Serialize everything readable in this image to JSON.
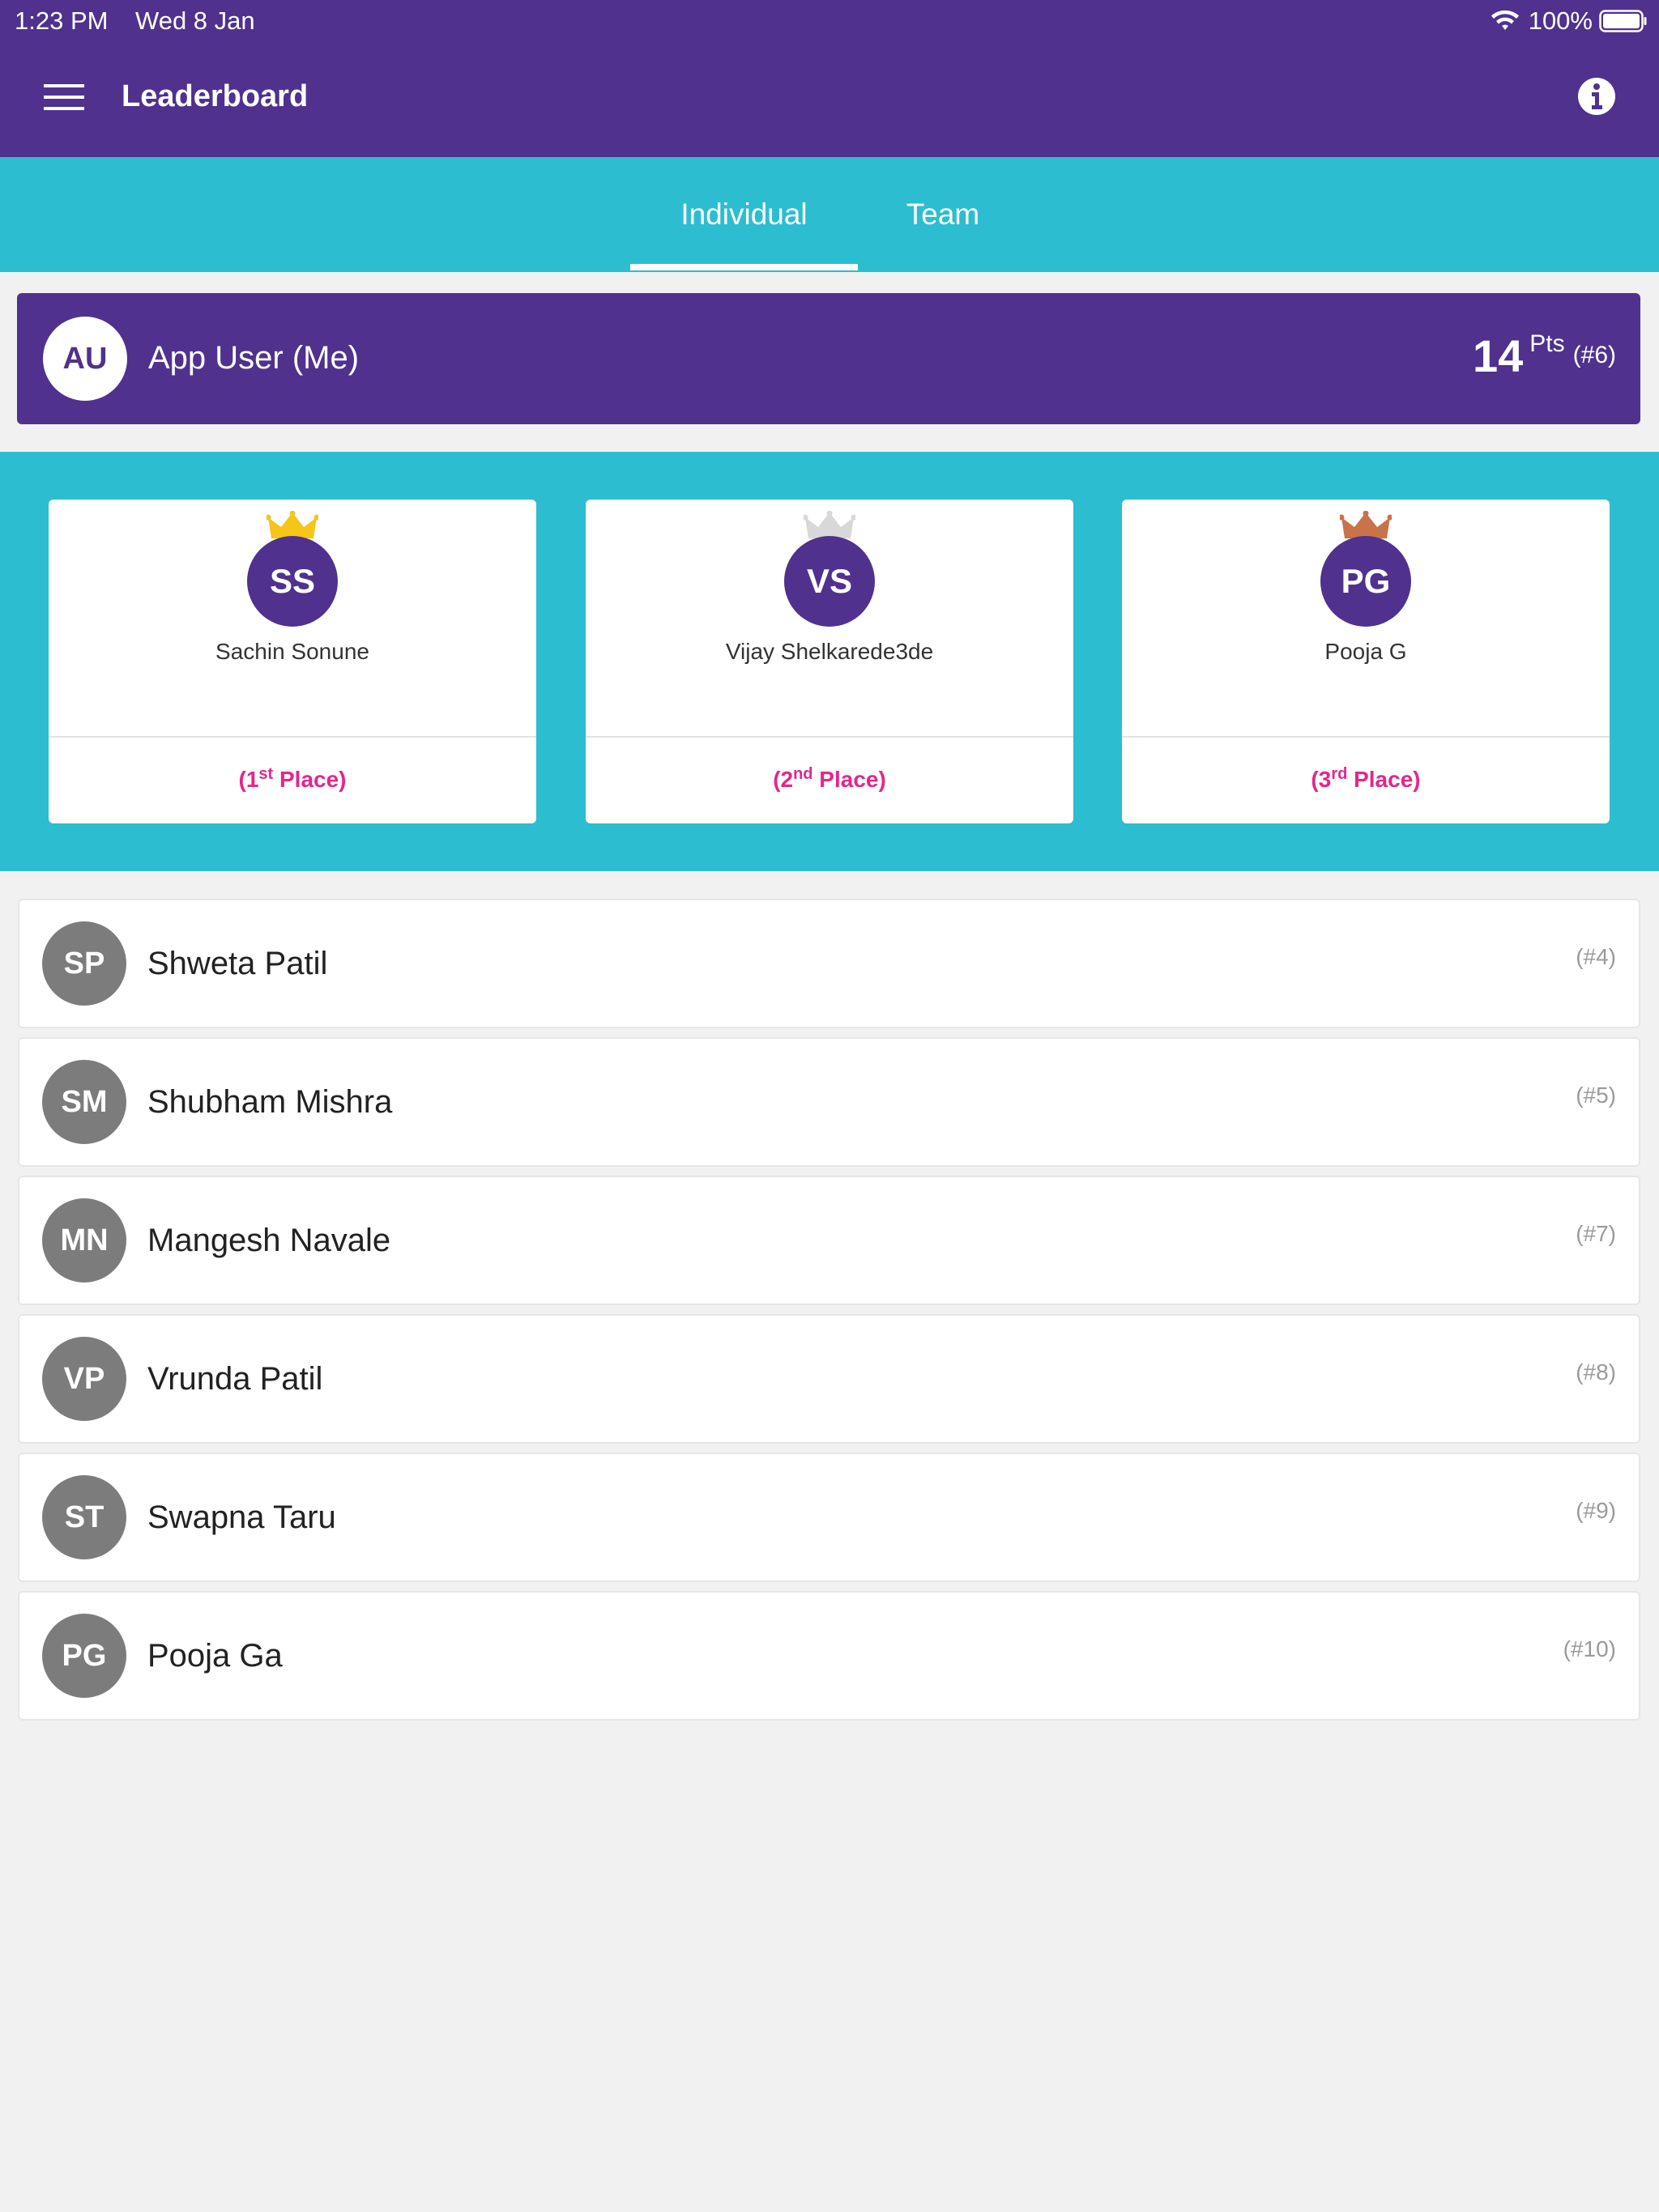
{
  "status_bar": {
    "time": "1:23 PM",
    "date": "Wed 8 Jan",
    "battery": "100%"
  },
  "header": {
    "title": "Leaderboard",
    "menu_icon": "hamburger-menu-icon",
    "info_icon": "info-icon"
  },
  "tabs": [
    {
      "label": "Individual",
      "active": true
    },
    {
      "label": "Team",
      "active": false
    }
  ],
  "me": {
    "initials": "AU",
    "name": "App User (Me)",
    "points": "14",
    "points_label": "Pts",
    "rank": "(#6)"
  },
  "podium": [
    {
      "initials": "SS",
      "name": "Sachin Sonune",
      "place_open": "(1",
      "place_sup": "st",
      "place_close": " Place)",
      "crown_color": "#f5c518"
    },
    {
      "initials": "VS",
      "name": "Vijay Shelkarede3de",
      "place_open": "(2",
      "place_sup": "nd",
      "place_close": " Place)",
      "crown_color": "#d8d8d8"
    },
    {
      "initials": "PG",
      "name": "Pooja G",
      "place_open": "(3",
      "place_sup": "rd",
      "place_close": " Place)",
      "crown_color": "#c8734a"
    }
  ],
  "list": [
    {
      "initials": "SP",
      "name": "Shweta Patil",
      "rank": "(#4)"
    },
    {
      "initials": "SM",
      "name": "Shubham Mishra",
      "rank": "(#5)"
    },
    {
      "initials": "MN",
      "name": "Mangesh Navale",
      "rank": "(#7)"
    },
    {
      "initials": "VP",
      "name": "Vrunda Patil",
      "rank": "(#8)"
    },
    {
      "initials": "ST",
      "name": "Swapna Taru",
      "rank": "(#9)"
    },
    {
      "initials": "PG",
      "name": "Pooja Ga",
      "rank": "(#10)"
    }
  ],
  "colors": {
    "primary": "#50318e",
    "accent": "#2dbdd0",
    "place_text": "#e4268d",
    "avatar_gray": "#7c7c7c"
  }
}
